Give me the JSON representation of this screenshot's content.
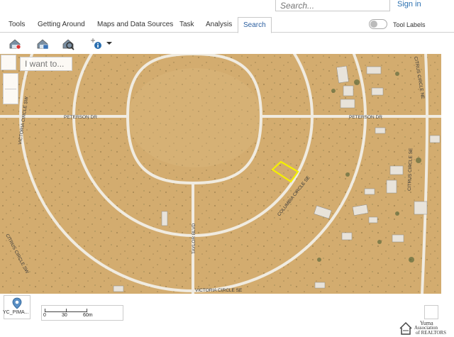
{
  "header": {
    "search_placeholder": "Search...",
    "sign_in_label": "Sign in"
  },
  "tabs": [
    {
      "label": "Tools"
    },
    {
      "label": "Getting Around"
    },
    {
      "label": "Maps and Data Sources"
    },
    {
      "label": "Task"
    },
    {
      "label": "Analysis"
    },
    {
      "label": "Search",
      "active": true
    }
  ],
  "tool_labels_toggle": {
    "label": "Tool Labels",
    "on": false
  },
  "toolbar": {
    "icons": [
      "search-parcel-icon",
      "search-address-icon",
      "search-zoom-icon",
      "identify-icon",
      "chevron-down-icon"
    ]
  },
  "map": {
    "i_want_to_placeholder": "I want to...",
    "road_labels": {
      "peterson_left": "PETERSON DR",
      "peterson_right": "PETERSON DR",
      "victoria_sw": "VICTORIA CIRCLE SW",
      "columbia_se": "COLUMBIA CIRCLE SE",
      "citrus_se": "CITRUS CIRCLE SE",
      "citrus_ne": "CITRUS CIRCLE NE",
      "citrus_sw": "CITRUS CIRCLE SW",
      "taylor": "TAYLOR BLVD",
      "victoria_se": "VICTORIA CIRCLE SE"
    },
    "colors": {
      "ground": "#cfa869",
      "road": "#f2ede4",
      "parcel_highlight": "#f5f000"
    }
  },
  "basemap": {
    "label": "YC_PIMA..."
  },
  "scale": {
    "labels": [
      "0",
      "30",
      "60m"
    ]
  },
  "logo": {
    "line1": "Yuma",
    "line2": "Association",
    "line3": "of REALTORS"
  }
}
